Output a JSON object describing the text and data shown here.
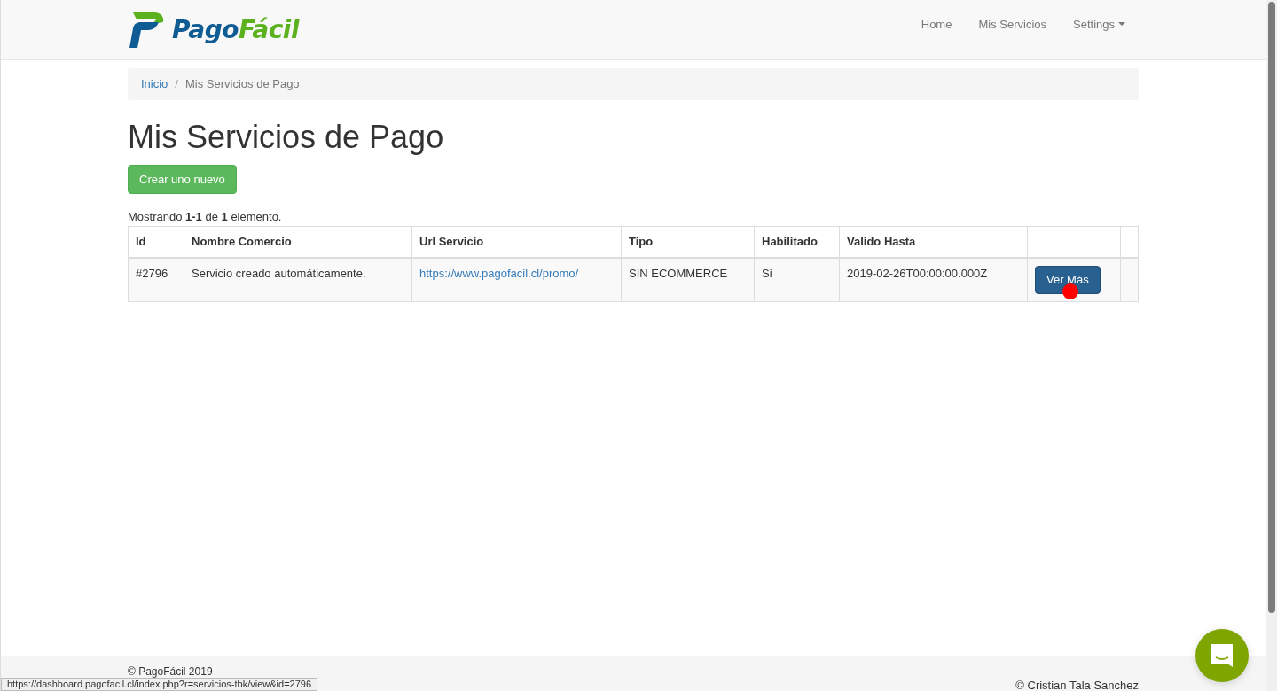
{
  "brand": {
    "part_1": "Pago",
    "part_2": "Fácil"
  },
  "nav": [
    {
      "label": "Home",
      "kind": "link"
    },
    {
      "label": "Mis Servicios",
      "kind": "link"
    },
    {
      "label": "Settings",
      "kind": "dropdown"
    }
  ],
  "breadcrumb": [
    {
      "label": "Inicio",
      "selected": false
    },
    {
      "label": "Mis Servicios de Pago",
      "selected": true
    }
  ],
  "breadcrumb_separator": "/",
  "title": "Mis Servicios de Pago",
  "create_button": "Crear uno nuevo",
  "summary": "Mostrando **1-1** de **1** elemento.",
  "table": {
    "columns": [
      "Id",
      "Nombre Comercio",
      "Url Servicio",
      "Tipo",
      "Habilitado",
      "Valido Hasta"
    ],
    "rows": [
      {
        "id": "#2796",
        "nombre": "Servicio creado automáticamente.",
        "url": "https://www.pagofacil.cl/promo/",
        "tipo": "SIN ECOMMERCE",
        "habilitado": "Si",
        "valido": "2019-02-26T00:00:00.000Z",
        "action": "Ver Más"
      }
    ]
  },
  "footer": {
    "left": "© PagoFácil 2019",
    "right": "© Cristian Tala Sanchez"
  },
  "status_url": "https://dashboard.pagofacil.cl/index.php?r=servicios-tbk/view&id=2796"
}
